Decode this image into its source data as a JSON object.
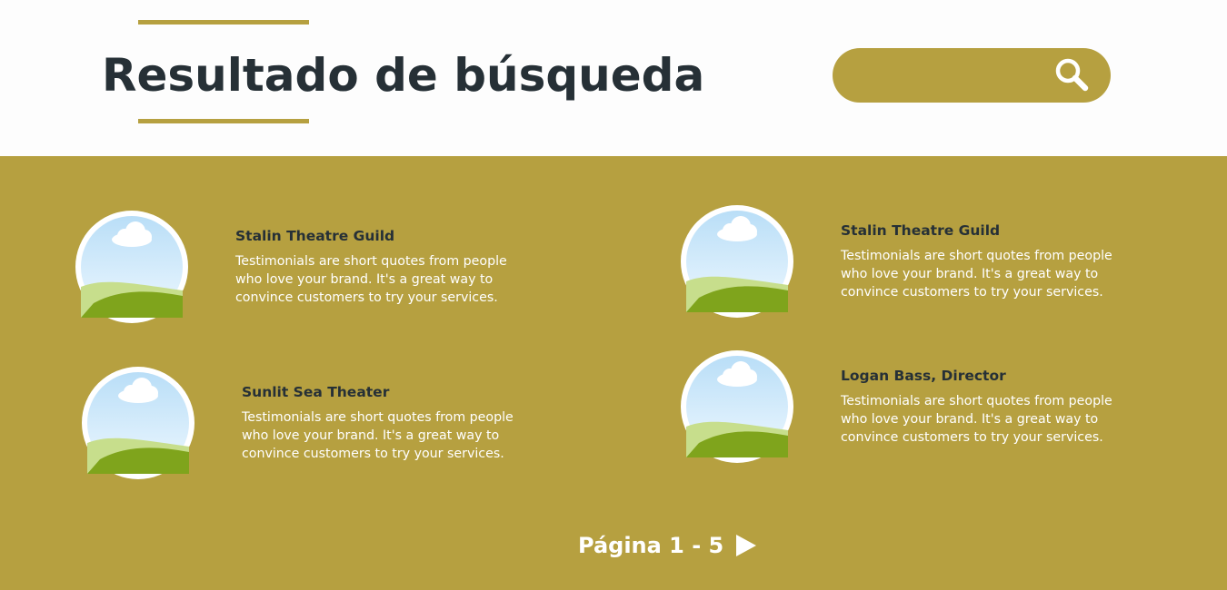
{
  "header": {
    "title": "Resultado de búsqueda"
  },
  "search": {
    "value": "",
    "placeholder": "",
    "icon": "search-icon"
  },
  "results": [
    {
      "name": "Stalin Theatre Guild",
      "description": "Testimonials are short quotes from people who love your brand. It's a great way to convince customers to try your services.",
      "icon": "landscape-image-icon"
    },
    {
      "name": "Stalin Theatre Guild",
      "description": "Testimonials are short quotes from people who love your brand. It's a great way to convince customers to try your services.",
      "icon": "landscape-image-icon"
    },
    {
      "name": "Sunlit Sea Theater",
      "description": "Testimonials are short quotes from people who love your brand. It's a great way to convince customers to try your services.",
      "icon": "landscape-image-icon"
    },
    {
      "name": "Logan Bass, Director",
      "description": "Testimonials are short quotes from people who love your brand. It's a great way to convince customers to try your services.",
      "icon": "landscape-image-icon"
    }
  ],
  "pagination": {
    "label": "Página 1 - 5",
    "next_icon": "play-arrow-icon"
  },
  "colors": {
    "accent": "#b6a040",
    "title": "#263036",
    "background": "#fdfdfd",
    "text_light": "#ffffff"
  }
}
